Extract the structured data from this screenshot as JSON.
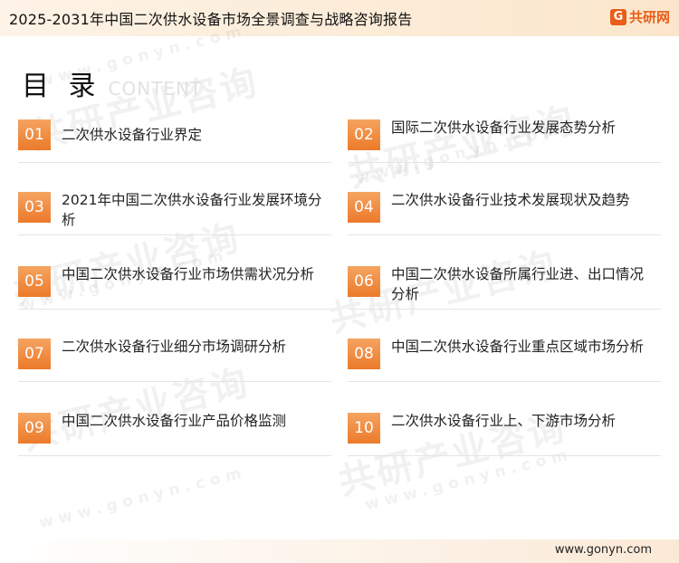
{
  "header": {
    "title": "2025-2031年中国二次供水设备市场全景调查与战略咨询报告",
    "brand_logo_glyph": "G",
    "brand_name": "共研网"
  },
  "heading": {
    "title_cn": "目 录",
    "title_en": "CONTENT"
  },
  "watermark": {
    "text_cn": "共研产业咨询",
    "text_en": "www.gonyn.com"
  },
  "toc": [
    {
      "num": "01",
      "label": "二次供水设备行业界定"
    },
    {
      "num": "02",
      "label": "国际二次供水设备行业发展态势分析"
    },
    {
      "num": "03",
      "label": "2021年中国二次供水设备行业发展环境分析"
    },
    {
      "num": "04",
      "label": "二次供水设备行业技术发展现状及趋势"
    },
    {
      "num": "05",
      "label": "中国二次供水设备行业市场供需状况分析"
    },
    {
      "num": "06",
      "label": "中国二次供水设备所属行业进、出口情况分析"
    },
    {
      "num": "07",
      "label": "二次供水设备行业细分市场调研分析"
    },
    {
      "num": "08",
      "label": "中国二次供水设备行业重点区域市场分析"
    },
    {
      "num": "09",
      "label": "中国二次供水设备行业产品价格监测"
    },
    {
      "num": "10",
      "label": "二次供水设备行业上、下游市场分析"
    }
  ],
  "footer": {
    "url": "www.gonyn.com"
  },
  "colors": {
    "accent": "#ec7a2a",
    "brand": "#e85d18",
    "header_bg": "#fbe6cc"
  }
}
